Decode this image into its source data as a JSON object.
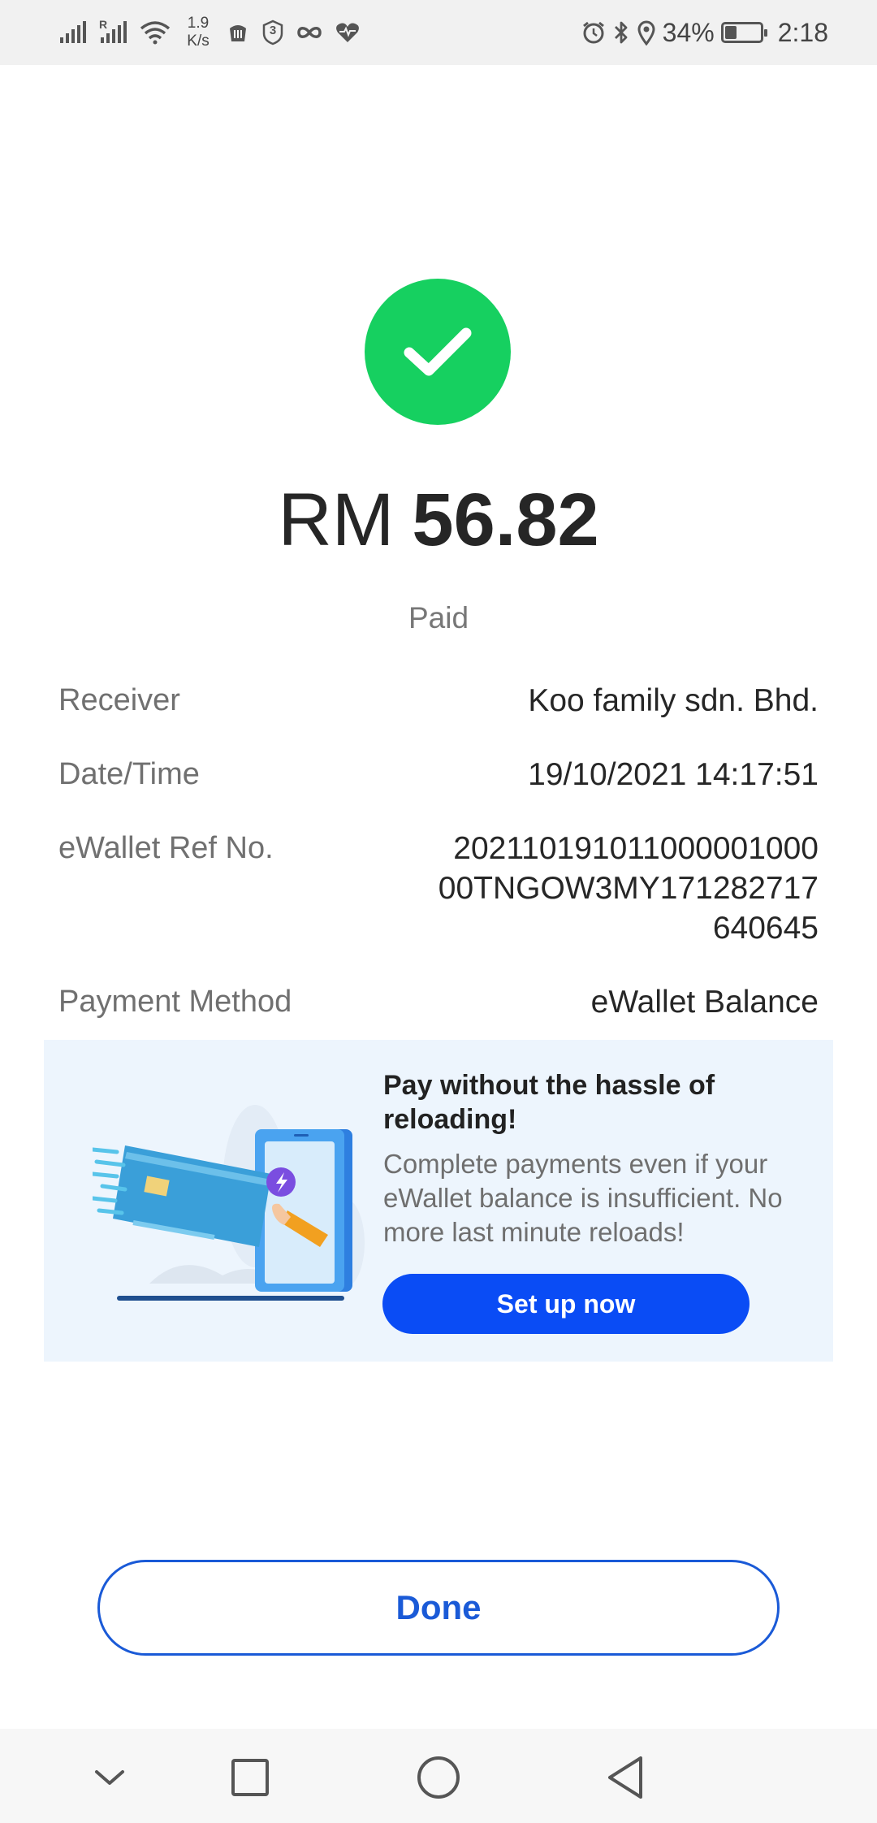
{
  "status_bar": {
    "net_speed_value": "1.9",
    "net_speed_unit": "K/s",
    "roaming_label": "R",
    "badge_number": "3",
    "battery_percent": "34%",
    "battery_level": 0.34,
    "time": "2:18",
    "icons": [
      "signal-icon",
      "signal-roaming-icon",
      "wifi-icon",
      "app-icon",
      "shield-badge-icon",
      "infinity-icon",
      "heart-pulse-icon",
      "alarm-icon",
      "bluetooth-icon",
      "location-icon",
      "battery-icon"
    ]
  },
  "payment": {
    "status_icon": "check-circle-icon",
    "currency": "RM",
    "amount": "56.82",
    "status": "Paid",
    "details": [
      {
        "label": "Receiver",
        "value": "Koo family sdn. Bhd."
      },
      {
        "label": "Date/Time",
        "value": "19/10/2021 14:17:51"
      },
      {
        "label": "eWallet Ref No.",
        "value": "20211019101100000100000TNGOW3MY171282717640645"
      },
      {
        "label": "Payment Method",
        "value": "eWallet Balance"
      }
    ]
  },
  "promo": {
    "title": "Pay without the hassle of reloading!",
    "description": "Complete payments even if your eWallet balance is insufficient. No more last minute reloads!",
    "button_label": "Set up now",
    "illustration": "card-phone-illustration"
  },
  "done_button_label": "Done",
  "nav_bar": {
    "buttons": [
      "chevron-down-icon",
      "recents-square-icon",
      "home-circle-icon",
      "back-triangle-icon"
    ]
  },
  "colors": {
    "success": "#16d060",
    "primary": "#0a4cf5",
    "done_text": "#1a5ad7",
    "promo_bg": "#edf5fd"
  }
}
